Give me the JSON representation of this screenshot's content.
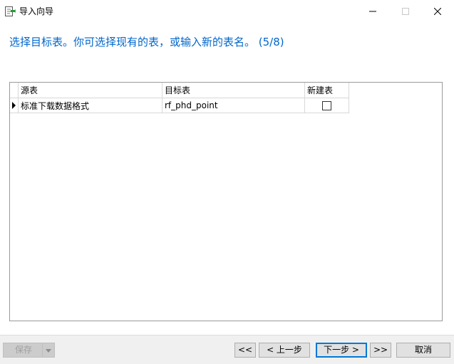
{
  "window": {
    "title": "导入向导",
    "icon": "import-wizard-icon"
  },
  "heading": "选择目标表。你可选择现有的表，或输入新的表名。 (5/8)",
  "grid": {
    "columns": [
      "源表",
      "目标表",
      "新建表"
    ],
    "rows": [
      {
        "source": "标准下载数据格式",
        "target": "rf_phd_point",
        "new_table": false
      }
    ]
  },
  "buttons": {
    "save": "保存",
    "first": "<<",
    "prev": "< 上一步",
    "next": "下一步 >",
    "last": ">>",
    "cancel": "取消"
  },
  "colors": {
    "heading": "#0066cc",
    "focus": "#0078d7"
  }
}
